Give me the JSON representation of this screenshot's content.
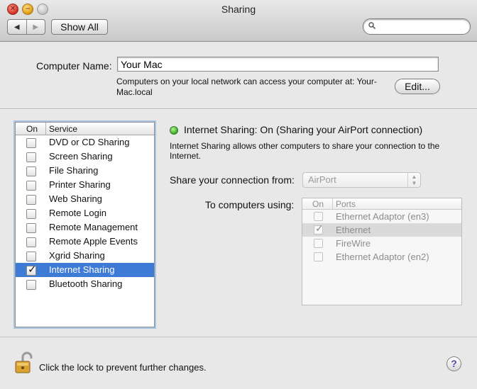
{
  "window": {
    "title": "Sharing",
    "close_glyph": "×",
    "minimize_glyph": "–"
  },
  "toolbar": {
    "back_glyph": "◀",
    "forward_glyph": "▶",
    "show_all_label": "Show All",
    "search_value": ""
  },
  "computer_name": {
    "label": "Computer Name:",
    "value": "Your Mac",
    "description": "Computers on your local network can access your computer at: Your-Mac.local",
    "edit_label": "Edit..."
  },
  "services": {
    "header_on": "On",
    "header_service": "Service",
    "items": [
      {
        "name": "DVD or CD Sharing",
        "checked": false,
        "selected": false
      },
      {
        "name": "Screen Sharing",
        "checked": false,
        "selected": false
      },
      {
        "name": "File Sharing",
        "checked": false,
        "selected": false
      },
      {
        "name": "Printer Sharing",
        "checked": false,
        "selected": false
      },
      {
        "name": "Web Sharing",
        "checked": false,
        "selected": false
      },
      {
        "name": "Remote Login",
        "checked": false,
        "selected": false
      },
      {
        "name": "Remote Management",
        "checked": false,
        "selected": false
      },
      {
        "name": "Remote Apple Events",
        "checked": false,
        "selected": false
      },
      {
        "name": "Xgrid Sharing",
        "checked": false,
        "selected": false
      },
      {
        "name": "Internet Sharing",
        "checked": true,
        "selected": true
      },
      {
        "name": "Bluetooth Sharing",
        "checked": false,
        "selected": false
      }
    ]
  },
  "detail": {
    "status_color": "#3fb01f",
    "status_text": "Internet Sharing: On (Sharing your AirPort connection)",
    "description": "Internet Sharing allows other computers to share your connection to the Internet.",
    "share_from_label": "Share your connection from:",
    "share_from_value": "AirPort",
    "to_computers_label": "To computers using:",
    "ports_header_on": "On",
    "ports_header_name": "Ports",
    "ports": [
      {
        "name": "Ethernet Adaptor (en3)",
        "checked": false,
        "selected": false
      },
      {
        "name": "Ethernet",
        "checked": true,
        "selected": true
      },
      {
        "name": "FireWire",
        "checked": false,
        "selected": false
      },
      {
        "name": "Ethernet Adaptor (en2)",
        "checked": false,
        "selected": false
      }
    ]
  },
  "footer": {
    "lock_text": "Click the lock to prevent further changes.",
    "help_label": "?"
  },
  "icons": {
    "close": "close-icon",
    "minimize": "minimize-icon",
    "zoom": "zoom-icon",
    "search": "search-icon",
    "lock": "lock-icon",
    "check": "checkmark-icon"
  },
  "colors": {
    "selection": "#3d7bd6",
    "list_focus_ring": "#a9c3e3"
  }
}
